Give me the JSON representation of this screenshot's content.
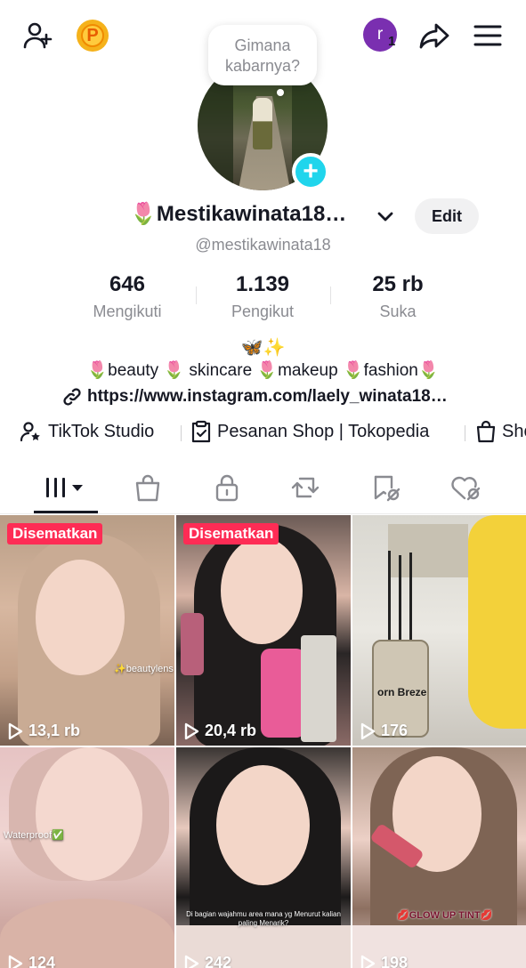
{
  "header": {
    "points_letter": "P",
    "account_initial": "r",
    "account_badge": "1"
  },
  "profile": {
    "note_bubble": "Gimana kabarnya?",
    "display_name": "🌷Mestikawinata18…",
    "edit_label": "Edit",
    "handle": "@mestikawinata18",
    "stats": [
      {
        "value": "646",
        "label": "Mengikuti"
      },
      {
        "value": "1.139",
        "label": "Pengikut"
      },
      {
        "value": "25 rb",
        "label": "Suka"
      }
    ],
    "bio_line1": "🦋✨",
    "bio_line2": "🌷beauty 🌷 skincare 🌷makeup 🌷fashion🌷",
    "link": "https://www.instagram.com/laely_winata18…"
  },
  "link_bar": {
    "studio": "TikTok Studio",
    "orders": "Pesanan Shop | Tokopedia",
    "shop": "Sho"
  },
  "tabs": [
    "videos",
    "shop",
    "private",
    "reposts",
    "favorites",
    "liked"
  ],
  "videos": [
    {
      "pinned": "Disematkan",
      "views": "13,1 rb",
      "overlay": "✨beautylens"
    },
    {
      "pinned": "Disematkan",
      "views": "20,4 rb",
      "overlay": ""
    },
    {
      "pinned": "",
      "views": "176",
      "overlay": "orn Breze"
    },
    {
      "pinned": "",
      "views": "124",
      "overlay": "Waterproof✅"
    },
    {
      "pinned": "",
      "views": "242",
      "overlay": "Di bagian wajahmu area mana yg Menurut kalian paling Menarik?"
    },
    {
      "pinned": "",
      "views": "198",
      "overlay": "💋GLOW UP TINT💋"
    }
  ],
  "colors": {
    "accent": "#fe2c55",
    "plus": "#20d5ec",
    "text": "#161823",
    "muted": "#8a8b91"
  }
}
